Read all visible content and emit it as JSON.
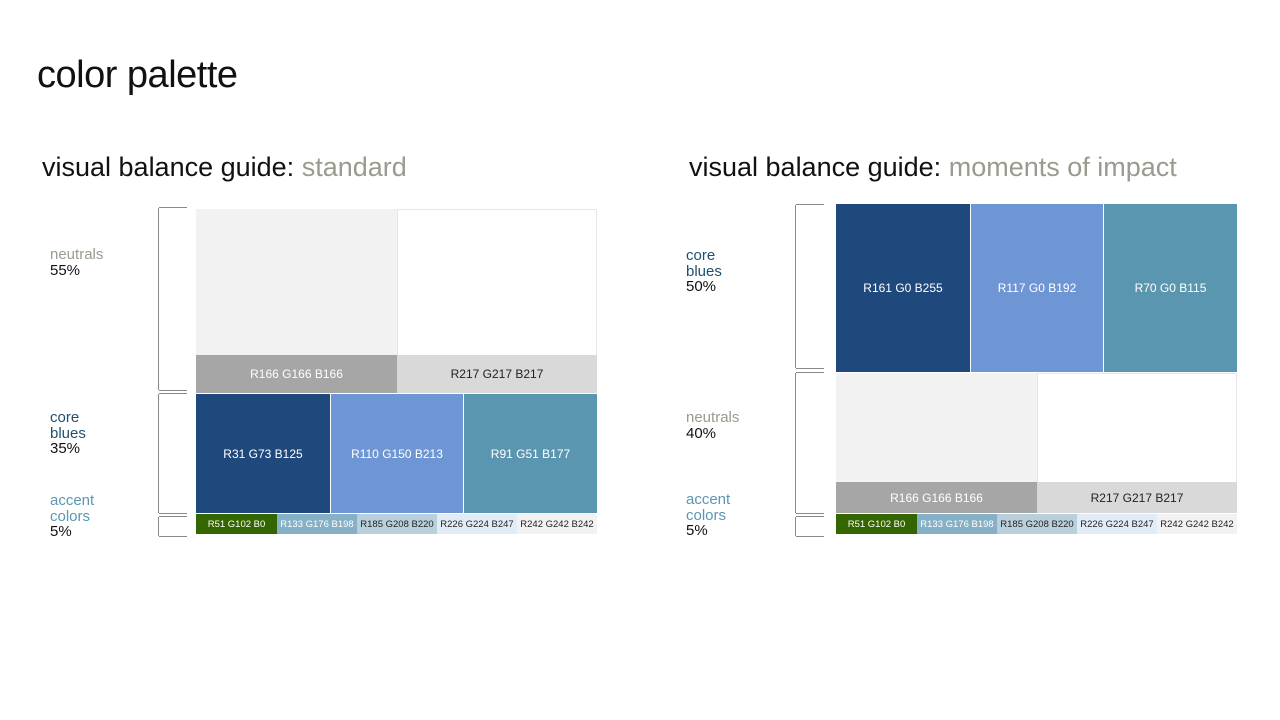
{
  "page_title": "color palette",
  "left": {
    "heading": "visual balance guide:",
    "subheading": "standard",
    "categories": {
      "neutrals": {
        "name": "neutrals",
        "pct": "55%",
        "color": "#9a9a8f"
      },
      "core_blues": {
        "name_line1": "core",
        "name_line2": "blues",
        "pct": "35%",
        "color": "#1f4f6e"
      },
      "accent": {
        "name_line1": "accent",
        "name_line2": "colors",
        "pct": "5%",
        "color": "#5b96b2"
      }
    },
    "neutrals": [
      {
        "label": "R166 G166 B166",
        "color": "#a6a6a6",
        "tint": "#f2f2f2"
      },
      {
        "label": "R217 G217 B217",
        "color": "#d9d9d9",
        "tint": "#ffffff"
      }
    ],
    "blues": [
      {
        "label": "R31 G73 B125",
        "color": "#1f497d"
      },
      {
        "label": "R110 G150 B213",
        "color": "#6e96d5"
      },
      {
        "label": "R91 G51 B177",
        "color": "#5b96b1"
      }
    ],
    "accents": [
      {
        "label": "R51 G102 B0",
        "color": "#336600"
      },
      {
        "label": "R133 G176 B198",
        "color": "#85b0c6"
      },
      {
        "label": "R185 G208 B220",
        "color": "#b9d0dc"
      },
      {
        "label": "R226 G224 B247",
        "color": "#e2ecf7"
      },
      {
        "label": "R242 G242 B242",
        "color": "#f2f2f2"
      }
    ]
  },
  "right": {
    "heading": "visual balance guide:",
    "subheading": "moments of impact",
    "categories": {
      "core_blues": {
        "name_line1": "core",
        "name_line2": "blues",
        "pct": "50%",
        "color": "#1f4f6e"
      },
      "neutrals": {
        "name": "neutrals",
        "pct": "40%",
        "color": "#9a9a8f"
      },
      "accent": {
        "name_line1": "accent",
        "name_line2": "colors",
        "pct": "5%",
        "color": "#5b96b2"
      }
    },
    "blues": [
      {
        "label": "R161 G0 B255",
        "color": "#1f497d"
      },
      {
        "label": "R117 G0 B192",
        "color": "#6e96d5"
      },
      {
        "label": "R70 G0 B115",
        "color": "#5b96b1"
      }
    ],
    "neutrals": [
      {
        "label": "R166 G166 B166",
        "color": "#a6a6a6",
        "tint": "#f2f2f2"
      },
      {
        "label": "R217 G217 B217",
        "color": "#d9d9d9",
        "tint": "#ffffff"
      }
    ],
    "accents": [
      {
        "label": "R51 G102 B0",
        "color": "#336600"
      },
      {
        "label": "R133 G176 B198",
        "color": "#85b0c6"
      },
      {
        "label": "R185 G208 B220",
        "color": "#b9d0dc"
      },
      {
        "label": "R226 G224 B247",
        "color": "#e2ecf7"
      },
      {
        "label": "R242 G242 B242",
        "color": "#f2f2f2"
      }
    ]
  }
}
